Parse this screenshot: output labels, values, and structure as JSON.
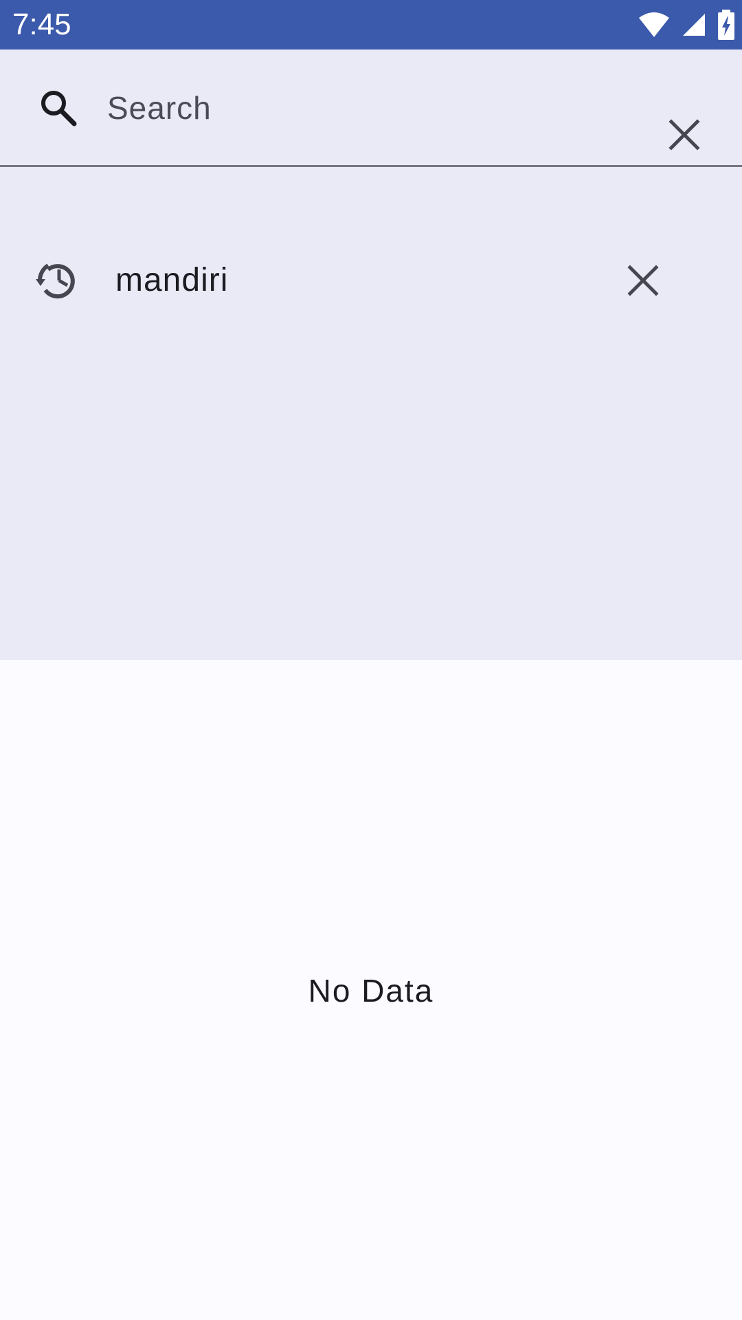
{
  "status_bar": {
    "time": "7:45",
    "icons": [
      "wifi-icon",
      "cell-signal-icon",
      "battery-charging-icon"
    ],
    "background_color": "#3b5aab"
  },
  "search": {
    "placeholder": "Search",
    "value": "",
    "icon": "search-icon",
    "clear_icon": "close-icon",
    "panel_color": "#e9eaf5"
  },
  "history": {
    "items": [
      {
        "label": "mandiri",
        "icon": "history-icon",
        "remove_icon": "close-icon"
      }
    ]
  },
  "results": {
    "empty_message": "No Data"
  }
}
